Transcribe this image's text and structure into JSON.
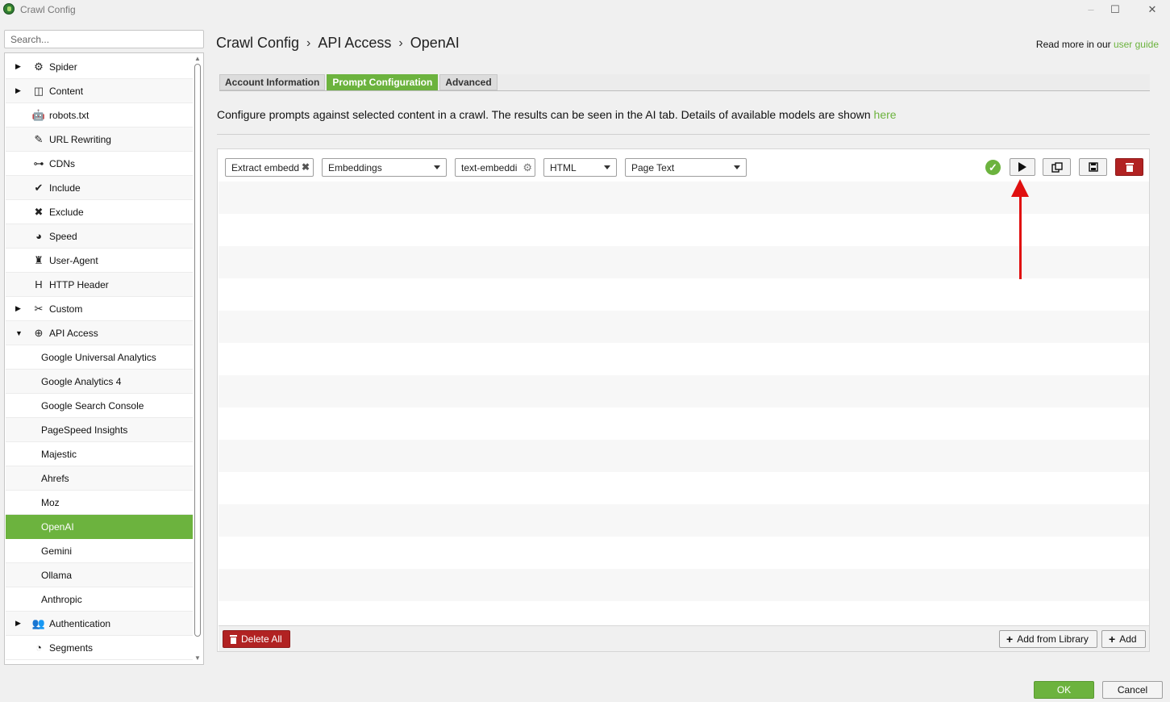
{
  "window": {
    "title": "Crawl Config",
    "minimize": "–",
    "maximize": "☐",
    "close": "✕"
  },
  "search": {
    "placeholder": "Search..."
  },
  "sidebar": {
    "items": [
      {
        "label": "Spider",
        "icon": "gear-icon",
        "glyph": "⚙",
        "expandable": true,
        "expanded": false
      },
      {
        "label": "Content",
        "icon": "content-icon",
        "glyph": "◫",
        "expandable": true,
        "expanded": false
      },
      {
        "label": "robots.txt",
        "icon": "robot-icon",
        "glyph": "🤖"
      },
      {
        "label": "URL Rewriting",
        "icon": "edit-icon",
        "glyph": "✎"
      },
      {
        "label": "CDNs",
        "icon": "network-icon",
        "glyph": "⊶"
      },
      {
        "label": "Include",
        "icon": "check-circle-icon",
        "glyph": "✔"
      },
      {
        "label": "Exclude",
        "icon": "x-circle-icon",
        "glyph": "✖"
      },
      {
        "label": "Speed",
        "icon": "gauge-icon",
        "glyph": "◕"
      },
      {
        "label": "User-Agent",
        "icon": "user-secret-icon",
        "glyph": "♜"
      },
      {
        "label": "HTTP Header",
        "icon": "heading-icon",
        "glyph": "H"
      },
      {
        "label": "Custom",
        "icon": "tools-icon",
        "glyph": "✂",
        "expandable": true,
        "expanded": false
      },
      {
        "label": "API Access",
        "icon": "globe-icon",
        "glyph": "⊕",
        "expandable": true,
        "expanded": true
      },
      {
        "label": "Google Universal Analytics",
        "child": true
      },
      {
        "label": "Google Analytics 4",
        "child": true
      },
      {
        "label": "Google Search Console",
        "child": true
      },
      {
        "label": "PageSpeed Insights",
        "child": true
      },
      {
        "label": "Majestic",
        "child": true
      },
      {
        "label": "Ahrefs",
        "child": true
      },
      {
        "label": "Moz",
        "child": true
      },
      {
        "label": "OpenAI",
        "child": true,
        "selected": true
      },
      {
        "label": "Gemini",
        "child": true
      },
      {
        "label": "Ollama",
        "child": true
      },
      {
        "label": "Anthropic",
        "child": true
      },
      {
        "label": "Authentication",
        "icon": "users-lock-icon",
        "glyph": "👥",
        "expandable": true,
        "expanded": false
      },
      {
        "label": "Segments",
        "icon": "pie-chart-icon",
        "glyph": "◔"
      }
    ]
  },
  "breadcrumb": [
    "Crawl Config",
    "API Access",
    "OpenAI"
  ],
  "breadcrumb_separator": "›",
  "read_more": {
    "prefix": "Read more in our ",
    "link": "user guide"
  },
  "tabs": [
    {
      "label": "Account Information",
      "active": false
    },
    {
      "label": "Prompt Configuration",
      "active": true
    },
    {
      "label": "Advanced",
      "active": false
    }
  ],
  "description": {
    "text": "Configure prompts against selected content in a crawl. The results can be seen in the AI tab. Details of available models are shown ",
    "link": "here"
  },
  "prompt_row": {
    "name": "Extract embedd",
    "type": "Embeddings",
    "model": "text-embeddi",
    "content_format": "HTML",
    "content_type": "Page Text",
    "status": "valid"
  },
  "footer": {
    "delete_all": "Delete All",
    "add_from_library": "Add from Library",
    "add": "Add"
  },
  "dialog": {
    "ok": "OK",
    "cancel": "Cancel"
  },
  "colors": {
    "accent": "#6cb33e",
    "danger": "#b12222",
    "annotation": "#e01010"
  }
}
